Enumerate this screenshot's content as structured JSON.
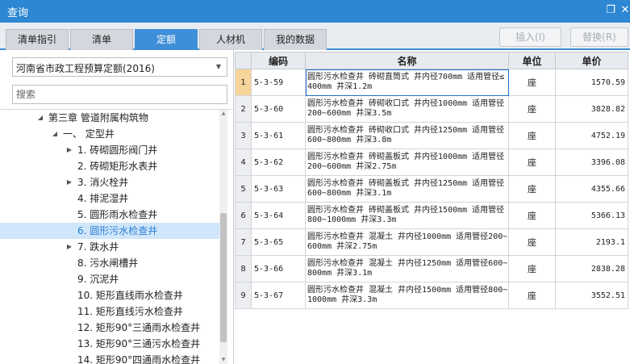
{
  "window": {
    "title": "查询",
    "restore_glyph": "❐",
    "close_glyph": "✕"
  },
  "tabs": [
    {
      "label": "清单指引",
      "active": false
    },
    {
      "label": "清单",
      "active": false
    },
    {
      "label": "定额",
      "active": true
    },
    {
      "label": "人材机",
      "active": false
    },
    {
      "label": "我的数据",
      "active": false
    }
  ],
  "actions": {
    "insert_label": "插入(I)",
    "replace_label": "替换(R)"
  },
  "left": {
    "library_select": "河南省市政工程预算定额(2016)",
    "search_placeholder": "搜索",
    "tree": [
      {
        "label": "第三章 管道附属构筑物",
        "toggle": "collapse",
        "level": 0
      },
      {
        "label": "一、 定型井",
        "toggle": "collapse",
        "level": 1
      },
      {
        "label": "1. 砖砌圆形阀门井",
        "toggle": "expand",
        "level": 2
      },
      {
        "label": "2. 砖砌矩形水表井",
        "toggle": "none",
        "level": 2
      },
      {
        "label": "3. 消火栓井",
        "toggle": "expand",
        "level": 2
      },
      {
        "label": "4. 排泥湿井",
        "toggle": "none",
        "level": 2
      },
      {
        "label": "5. 圆形雨水检查井",
        "toggle": "none",
        "level": 2
      },
      {
        "label": "6. 圆形污水检查井",
        "toggle": "none",
        "level": 2,
        "selected": true
      },
      {
        "label": "7. 跌水井",
        "toggle": "expand",
        "level": 2
      },
      {
        "label": "8. 污水闸槽井",
        "toggle": "none",
        "level": 2
      },
      {
        "label": "9. 沉泥井",
        "toggle": "none",
        "level": 2
      },
      {
        "label": "10. 矩形直线雨水检查井",
        "toggle": "none",
        "level": 2
      },
      {
        "label": "11. 矩形直线污水检查井",
        "toggle": "none",
        "level": 2
      },
      {
        "label": "12. 矩形90°三通雨水检查井",
        "toggle": "none",
        "level": 2
      },
      {
        "label": "13. 矩形90°三通污水检查井",
        "toggle": "none",
        "level": 2
      },
      {
        "label": "14. 矩形90°四通雨水检查井",
        "toggle": "none",
        "level": 2
      }
    ],
    "toggle_glyphs": {
      "collapse": "◢",
      "expand": "▶",
      "none": ""
    }
  },
  "grid": {
    "columns": {
      "code": "编码",
      "name": "名称",
      "unit": "单位",
      "price": "单价"
    },
    "rows": [
      {
        "no": "1",
        "code": "5-3-59",
        "name": "圆形污水检查井 砖砌直筒式 井内径700mm 适用管径≤400mm 井深1.2m",
        "unit": "座",
        "price": "1570.59",
        "selected": true
      },
      {
        "no": "2",
        "code": "5-3-60",
        "name": "圆形污水检查井 砖砌收口式 井内径1000mm 适用管径200~600mm 井深3.5m",
        "unit": "座",
        "price": "3828.82"
      },
      {
        "no": "3",
        "code": "5-3-61",
        "name": "圆形污水检查井 砖砌收口式 井内径1250mm 适用管径600~800mm 井深3.8m",
        "unit": "座",
        "price": "4752.19"
      },
      {
        "no": "4",
        "code": "5-3-62",
        "name": "圆形污水检查井 砖砌盖板式 井内径1000mm 适用管径200~600mm 井深2.75m",
        "unit": "座",
        "price": "3396.08"
      },
      {
        "no": "5",
        "code": "5-3-63",
        "name": "圆形污水检查井 砖砌盖板式 井内径1250mm 适用管径600~800mm 井深3.1m",
        "unit": "座",
        "price": "4355.66"
      },
      {
        "no": "6",
        "code": "5-3-64",
        "name": "圆形污水检查井 砖砌盖板式 井内径1500mm 适用管径800~1000mm 井深3.3m",
        "unit": "座",
        "price": "5366.13"
      },
      {
        "no": "7",
        "code": "5-3-65",
        "name": "圆形污水检查井 混凝土 井内径1000mm 适用管径200~600mm 井深2.75m",
        "unit": "座",
        "price": "2193.1"
      },
      {
        "no": "8",
        "code": "5-3-66",
        "name": "圆形污水检查井 混凝土 井内径1250mm 适用管径600~800mm 井深3.1m",
        "unit": "座",
        "price": "2838.28"
      },
      {
        "no": "9",
        "code": "5-3-67",
        "name": "圆形污水检查井 混凝土 井内径1500mm 适用管径800~1000mm 井深3.3m",
        "unit": "座",
        "price": "3552.51"
      }
    ]
  }
}
